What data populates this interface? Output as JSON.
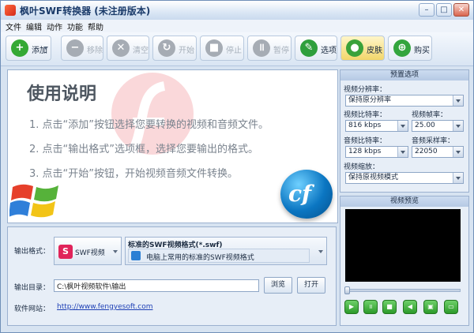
{
  "window": {
    "title": "枫叶SWF转换器 (未注册版本)",
    "min": "–",
    "max": "□",
    "close": "✕"
  },
  "menu": [
    "文件",
    "编辑",
    "动作",
    "功能",
    "帮助"
  ],
  "toolbar": [
    {
      "label": "添加",
      "icon": "plus-icon",
      "glyph": "+",
      "color": "#35a934",
      "enabled": true
    },
    {
      "label": "移除",
      "icon": "minus-icon",
      "glyph": "−",
      "enabled": false
    },
    {
      "label": "清空",
      "icon": "clear-icon",
      "glyph": "✕",
      "enabled": false
    },
    {
      "label": "开始",
      "icon": "refresh-icon",
      "glyph": "↻",
      "enabled": false
    },
    {
      "label": "停止",
      "icon": "stop-icon",
      "glyph": "■",
      "enabled": false
    },
    {
      "label": "暂停",
      "icon": "pause-icon",
      "glyph": "॥",
      "enabled": false
    },
    {
      "label": "选项",
      "icon": "tools-icon",
      "glyph": "✎",
      "color": "#2f9f3c",
      "enabled": true
    },
    {
      "label": "皮肤",
      "icon": "apple-icon",
      "glyph": "●",
      "color": "#3aa23a",
      "enabled": true
    },
    {
      "label": "购买",
      "icon": "cart-icon",
      "glyph": "⊕",
      "color": "#33a53d",
      "enabled": true
    }
  ],
  "help": {
    "title": "使用说明",
    "lines": [
      "1. 点击“添加”按钮选择您要转换的视频和音频文件。",
      "2. 点击“输出格式”选项框，选择您要输出的格式。",
      "3. 点击“开始”按钮，开始视频音频文件转换。"
    ],
    "cf_logo": "cf"
  },
  "output": {
    "format_label": "输出格式：",
    "format_value": "SWF视频",
    "format_icon_text": "S",
    "format_title": "标准的SWF视频格式(*.swf)",
    "format_desc": "电脑上常用的标准的SWF视频格式",
    "dir_label": "输出目录：",
    "dir_value": "C:\\枫叶视频软件\\输出",
    "browse": "浏览",
    "open": "打开",
    "site_label": "软件网站：",
    "site_url": "http://www.fengyesoft.com"
  },
  "preset": {
    "title": "预置选项",
    "resolution_label": "视频分辨率：",
    "resolution_value": "保持原分辨率",
    "vbitrate_label": "视频比特率：",
    "vbitrate_value": "816 kbps",
    "fps_label": "视频帧率：",
    "fps_value": "25.00",
    "abitrate_label": "音频比特率：",
    "abitrate_value": "128 kbps",
    "samplerate_label": "音频采样率：",
    "samplerate_value": "22050",
    "zoom_label": "视频缩放：",
    "zoom_value": "保持原视频模式"
  },
  "preview": {
    "title": "视频预览",
    "position": 0
  },
  "player": [
    {
      "name": "play-button",
      "glyph": "▶"
    },
    {
      "name": "pause-button",
      "glyph": "॥"
    },
    {
      "name": "stop-button",
      "glyph": "■"
    },
    {
      "name": "volume-button",
      "glyph": "◀"
    },
    {
      "name": "snapshot-button",
      "glyph": "▣"
    },
    {
      "name": "folder-button",
      "glyph": "▭"
    }
  ]
}
